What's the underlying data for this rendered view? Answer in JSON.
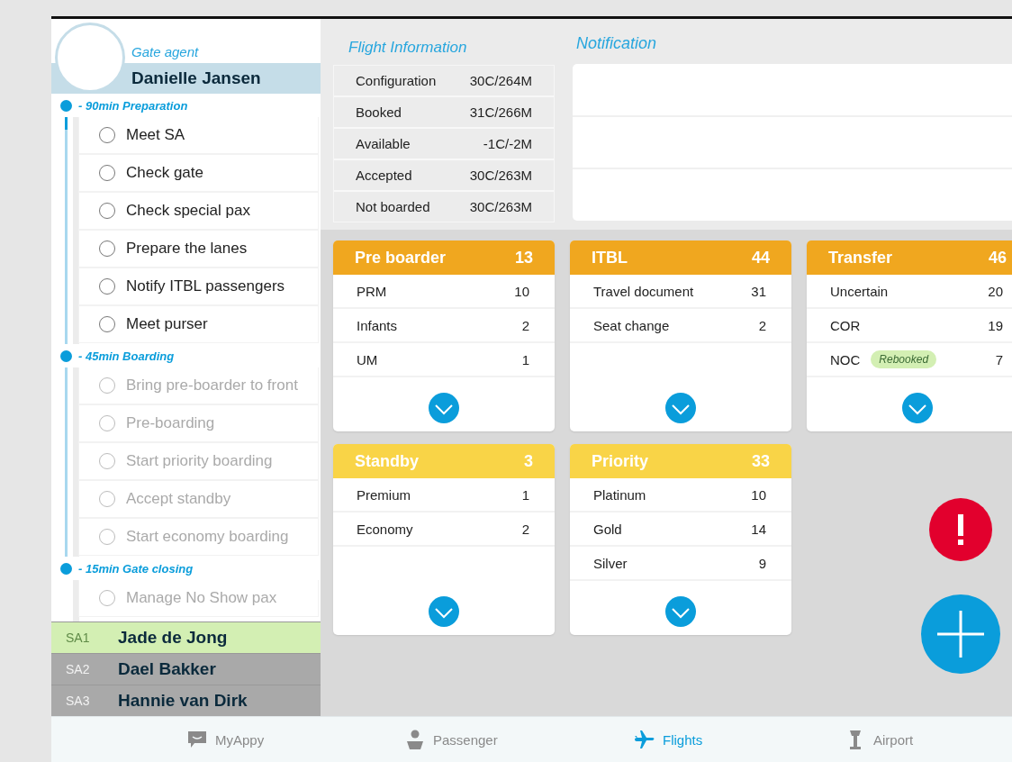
{
  "agent": {
    "role": "Gate agent",
    "name": "Danielle Jansen"
  },
  "phases": [
    {
      "label": "- 90min Preparation",
      "tasks": [
        {
          "label": "Meet SA",
          "checked": false,
          "disabled": false
        },
        {
          "label": "Check gate",
          "checked": false,
          "disabled": false
        },
        {
          "label": "Check special pax",
          "checked": false,
          "disabled": false
        },
        {
          "label": "Prepare the lanes",
          "checked": false,
          "disabled": false
        },
        {
          "label": "Notify ITBL passengers",
          "checked": false,
          "disabled": false
        },
        {
          "label": "Meet purser",
          "checked": false,
          "disabled": false
        }
      ]
    },
    {
      "label": "- 45min Boarding",
      "tasks": [
        {
          "label": "Bring pre-boarder to front",
          "checked": false,
          "disabled": true
        },
        {
          "label": "Pre-boarding",
          "checked": false,
          "disabled": true
        },
        {
          "label": "Start priority boarding",
          "checked": false,
          "disabled": true
        },
        {
          "label": "Accept standby",
          "checked": false,
          "disabled": true
        },
        {
          "label": "Start economy boarding",
          "checked": false,
          "disabled": true
        }
      ]
    },
    {
      "label": "- 15min Gate closing",
      "tasks": [
        {
          "label": "Manage No Show pax",
          "checked": false,
          "disabled": true
        }
      ]
    }
  ],
  "service_agents": [
    {
      "code": "SA1",
      "name": "Jade de Jong",
      "selected": true
    },
    {
      "code": "SA2",
      "name": "Dael Bakker",
      "selected": false
    },
    {
      "code": "SA3",
      "name": "Hannie van Dirk",
      "selected": false
    }
  ],
  "flight_information": {
    "title": "Flight Information",
    "rows": [
      {
        "label": "Configuration",
        "value": "30C/264M"
      },
      {
        "label": "Booked",
        "value": "31C/266M"
      },
      {
        "label": "Available",
        "value": "-1C/-2M"
      },
      {
        "label": "Accepted",
        "value": "30C/263M"
      },
      {
        "label": "Not boarded",
        "value": "30C/263M"
      }
    ]
  },
  "notification": {
    "title": "Notification"
  },
  "cards": [
    {
      "title": "Pre boarder",
      "count": "13",
      "color": "#f0a71f",
      "rows": [
        {
          "label": "PRM",
          "value": "10"
        },
        {
          "label": "Infants",
          "value": "2"
        },
        {
          "label": "UM",
          "value": "1"
        }
      ]
    },
    {
      "title": "ITBL",
      "count": "44",
      "color": "#f0a71f",
      "rows": [
        {
          "label": "Travel document",
          "value": "31"
        },
        {
          "label": "Seat change",
          "value": "2"
        }
      ]
    },
    {
      "title": "Transfer",
      "count": "46",
      "color": "#f0a71f",
      "rows": [
        {
          "label": "Uncertain",
          "value": "20"
        },
        {
          "label": "COR",
          "value": "19"
        },
        {
          "label": "NOC",
          "badge": "Rebooked",
          "value": "7"
        }
      ]
    },
    {
      "title": "Standby",
      "count": "3",
      "color": "#f9d447",
      "rows": [
        {
          "label": "Premium",
          "value": "1"
        },
        {
          "label": "Economy",
          "value": "2"
        }
      ]
    },
    {
      "title": "Priority",
      "count": "33",
      "color": "#f9d447",
      "rows": [
        {
          "label": "Platinum",
          "value": "10"
        },
        {
          "label": "Gold",
          "value": "14"
        },
        {
          "label": "Silver",
          "value": "9"
        }
      ]
    }
  ],
  "nav": [
    {
      "label": "MyAppy",
      "selected": false
    },
    {
      "label": "Passenger",
      "selected": false
    },
    {
      "label": "Flights",
      "selected": true
    },
    {
      "label": "Airport",
      "selected": false
    }
  ]
}
